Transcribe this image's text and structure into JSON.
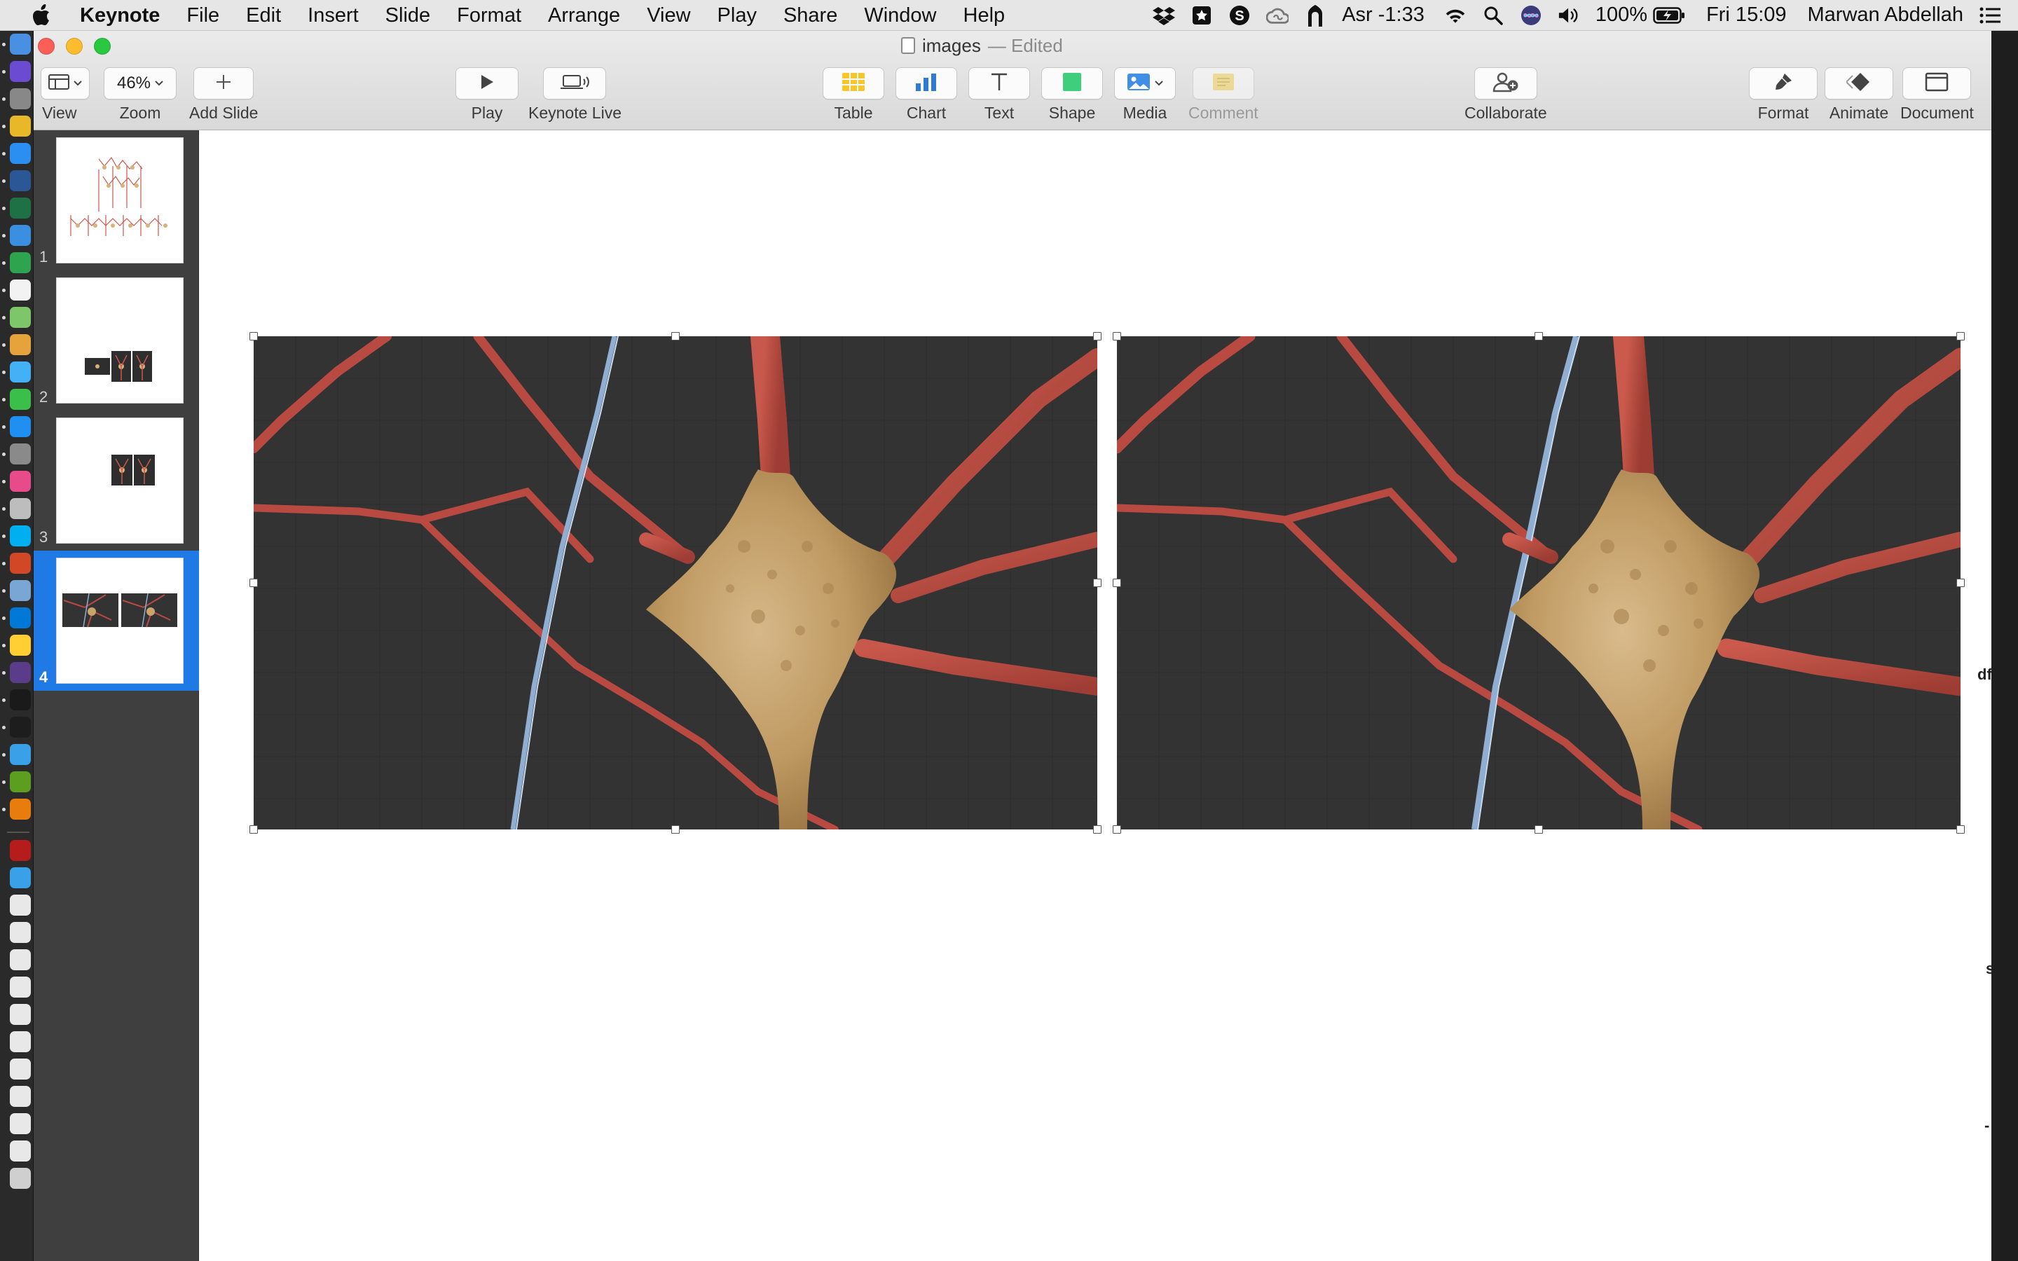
{
  "menubar": {
    "app_name": "Keynote",
    "items": [
      "File",
      "Edit",
      "Insert",
      "Slide",
      "Format",
      "Arrange",
      "View",
      "Play",
      "Share",
      "Window",
      "Help"
    ],
    "status": {
      "prayer": "Asr -1:33",
      "battery": "100%",
      "clock": "Fri 15:09",
      "user": "Marwan Abdellah"
    },
    "icons": [
      "apple-icon",
      "dropbox-icon",
      "reader-icon",
      "skype-icon",
      "creative-cloud-icon",
      "mosque-icon",
      "wifi-icon",
      "spotlight-icon",
      "siri-icon",
      "volume-icon",
      "battery-icon",
      "control-center-icon"
    ]
  },
  "window": {
    "title": "images",
    "edited_label": "— Edited",
    "toolbar": {
      "view_label": "View",
      "zoom_label": "Zoom",
      "zoom_value": "46%",
      "add_slide_label": "Add Slide",
      "play_label": "Play",
      "keynote_live_label": "Keynote Live",
      "table_label": "Table",
      "chart_label": "Chart",
      "text_label": "Text",
      "shape_label": "Shape",
      "media_label": "Media",
      "comment_label": "Comment",
      "collaborate_label": "Collaborate",
      "format_label": "Format",
      "animate_label": "Animate",
      "document_label": "Document"
    }
  },
  "navigator": {
    "slides": [
      {
        "number": "1",
        "selected": false
      },
      {
        "number": "2",
        "selected": false
      },
      {
        "number": "3",
        "selected": false
      },
      {
        "number": "4",
        "selected": true
      }
    ]
  },
  "canvas": {
    "edge_fragments": [
      "df",
      "s",
      "-"
    ]
  },
  "colors": {
    "selection_blue": "#1f7ae6",
    "background_dark": "#333333",
    "neurite_red": "#b84a42",
    "soma_gold": "#c9a56b",
    "axon_blue": "#8faed1",
    "axon_green": "#8bc46a"
  }
}
